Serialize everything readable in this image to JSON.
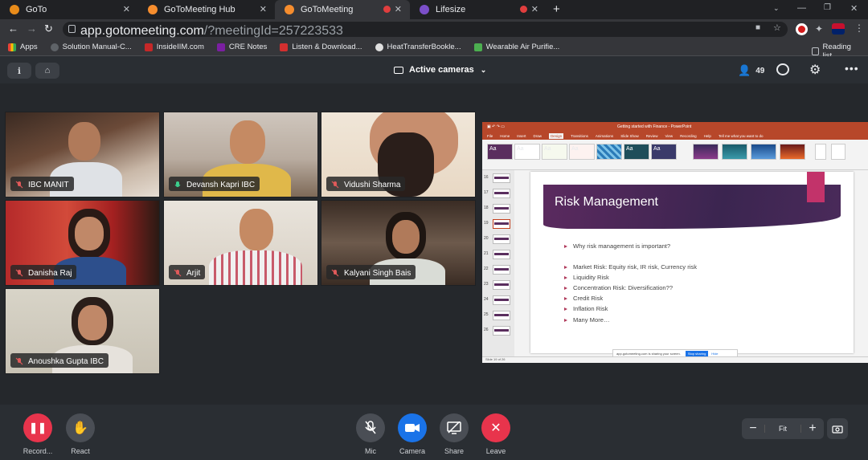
{
  "browser": {
    "tabs": [
      {
        "label": "GoTo",
        "color": "#e88b1a"
      },
      {
        "label": "GoToMeeting Hub",
        "color": "#f68d2e"
      },
      {
        "label": "GoToMeeting",
        "color": "#f68d2e"
      },
      {
        "label": "Lifesize",
        "color": "#7b4fc9"
      }
    ],
    "url_host": "app.gotomeeting.com",
    "url_path": "/?meetingId=257223533",
    "bookmarks": [
      "Apps",
      "Solution Manual-C...",
      "InsideIIM.com",
      "CRE Notes",
      "Listen & Download...",
      "HeatTransferBookle...",
      "Wearable Air Purifie..."
    ],
    "reading_list": "Reading list"
  },
  "meeting": {
    "view_label": "Active cameras",
    "attendee_count": "49",
    "participants": [
      {
        "name": "IBC MANIT",
        "mic": "muted"
      },
      {
        "name": "Devansh Kapri IBC",
        "mic": "on"
      },
      {
        "name": "Vidushi Sharma",
        "mic": "muted"
      },
      {
        "name": "Danisha Raj",
        "mic": "muted"
      },
      {
        "name": "Arjit",
        "mic": "muted"
      },
      {
        "name": "Kalyani Singh Bais",
        "mic": "muted"
      },
      {
        "name": "Anoushka Gupta IBC",
        "mic": "muted"
      }
    ],
    "controls": {
      "record": "Record...",
      "react": "React",
      "mic": "Mic",
      "camera": "Camera",
      "share": "Share",
      "leave": "Leave"
    },
    "zoom": {
      "fit": "Fit"
    }
  },
  "ppt": {
    "window_title": "Getting started with Finance - PowerPoint",
    "menu": [
      "File",
      "Home",
      "Insert",
      "Draw",
      "Design",
      "Transitions",
      "Animations",
      "Slide Show",
      "Review",
      "View",
      "Recording",
      "Help"
    ],
    "tell_me": "Tell me what you want to do",
    "slide_numbers": [
      "16",
      "17",
      "18",
      "19",
      "20",
      "21",
      "22",
      "23",
      "24",
      "25",
      "26"
    ],
    "slide_title": "Risk Management",
    "bullets": [
      "Why risk management is important?",
      "Market Risk: Equity risk, IR risk, Currency risk",
      "Liquidity Risk",
      "Concentration Risk: Diversification??",
      "Credit Risk",
      "Inflation Risk",
      "Many More…"
    ],
    "share_notice": "app.gotomeeting.com is sharing your screen.",
    "stop_sharing": "Stop sharing",
    "hide": "Hide",
    "status_left": "Slide 19 of 26"
  }
}
